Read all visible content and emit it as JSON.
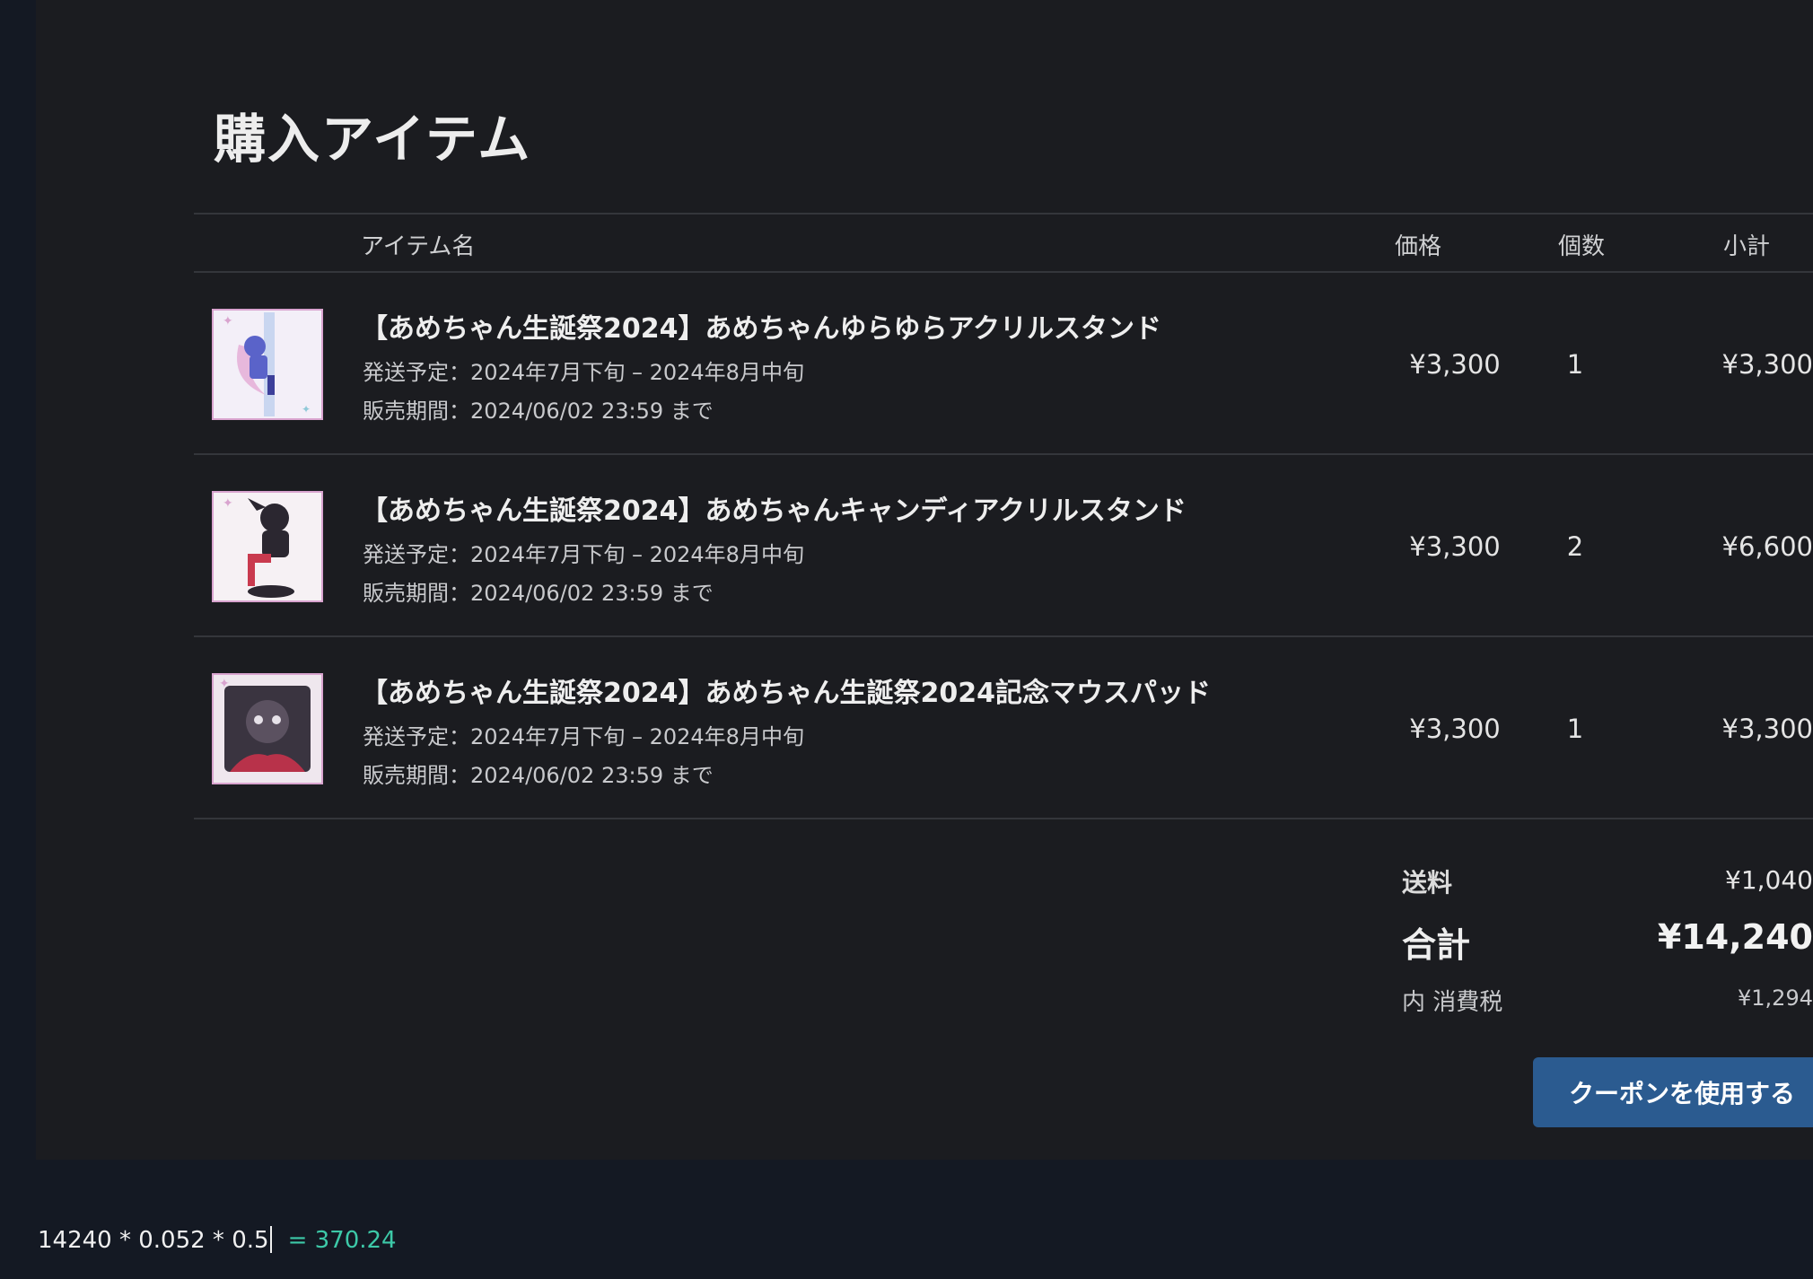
{
  "page_title": "購入アイテム",
  "columns": {
    "item_name": "アイテム名",
    "price": "価格",
    "quantity": "個数",
    "subtotal": "小計"
  },
  "items": [
    {
      "name": "【あめちゃん生誕祭2024】あめちゃんゆらゆらアクリルスタンド",
      "shipping": "発送予定：2024年7月下旬 – 2024年8月中旬",
      "sale_period": "販売期間：2024/06/02 23:59 まで",
      "price": "¥3,300",
      "quantity": "1",
      "subtotal": "¥3,300",
      "thumb_colors": {
        "bg": "#f3eff8",
        "main": "#5a63c9",
        "accent": "#d9a4cf"
      }
    },
    {
      "name": "【あめちゃん生誕祭2024】あめちゃんキャンディアクリルスタンド",
      "shipping": "発送予定：2024年7月下旬 – 2024年8月中旬",
      "sale_period": "販売期間：2024/06/02 23:59 まで",
      "price": "¥3,300",
      "quantity": "2",
      "subtotal": "¥6,600",
      "thumb_colors": {
        "bg": "#f6f1f4",
        "main": "#2b2730",
        "accent": "#c93a4e"
      }
    },
    {
      "name": "【あめちゃん生誕祭2024】あめちゃん生誕祭2024記念マウスパッド",
      "shipping": "発送予定：2024年7月下旬 – 2024年8月中旬",
      "sale_period": "販売期間：2024/06/02 23:59 まで",
      "price": "¥3,300",
      "quantity": "1",
      "subtotal": "¥3,300",
      "thumb_colors": {
        "bg": "#efe7ee",
        "main": "#3a3440",
        "accent": "#b8324a"
      }
    }
  ],
  "summary": {
    "shipping_label": "送料",
    "shipping_value": "¥1,040",
    "total_label": "合計",
    "total_value": "¥14,240",
    "tax_label": "内 消費税",
    "tax_value": "¥1,294"
  },
  "coupon_button": "クーポンを使用する",
  "calculator": {
    "expression": "14240 * 0.052 * 0.5",
    "result": "= 370.24"
  },
  "colors": {
    "background": "#141923",
    "panel": "#1b1c20",
    "button": "#2b5b90",
    "result": "#3dc9a8"
  }
}
